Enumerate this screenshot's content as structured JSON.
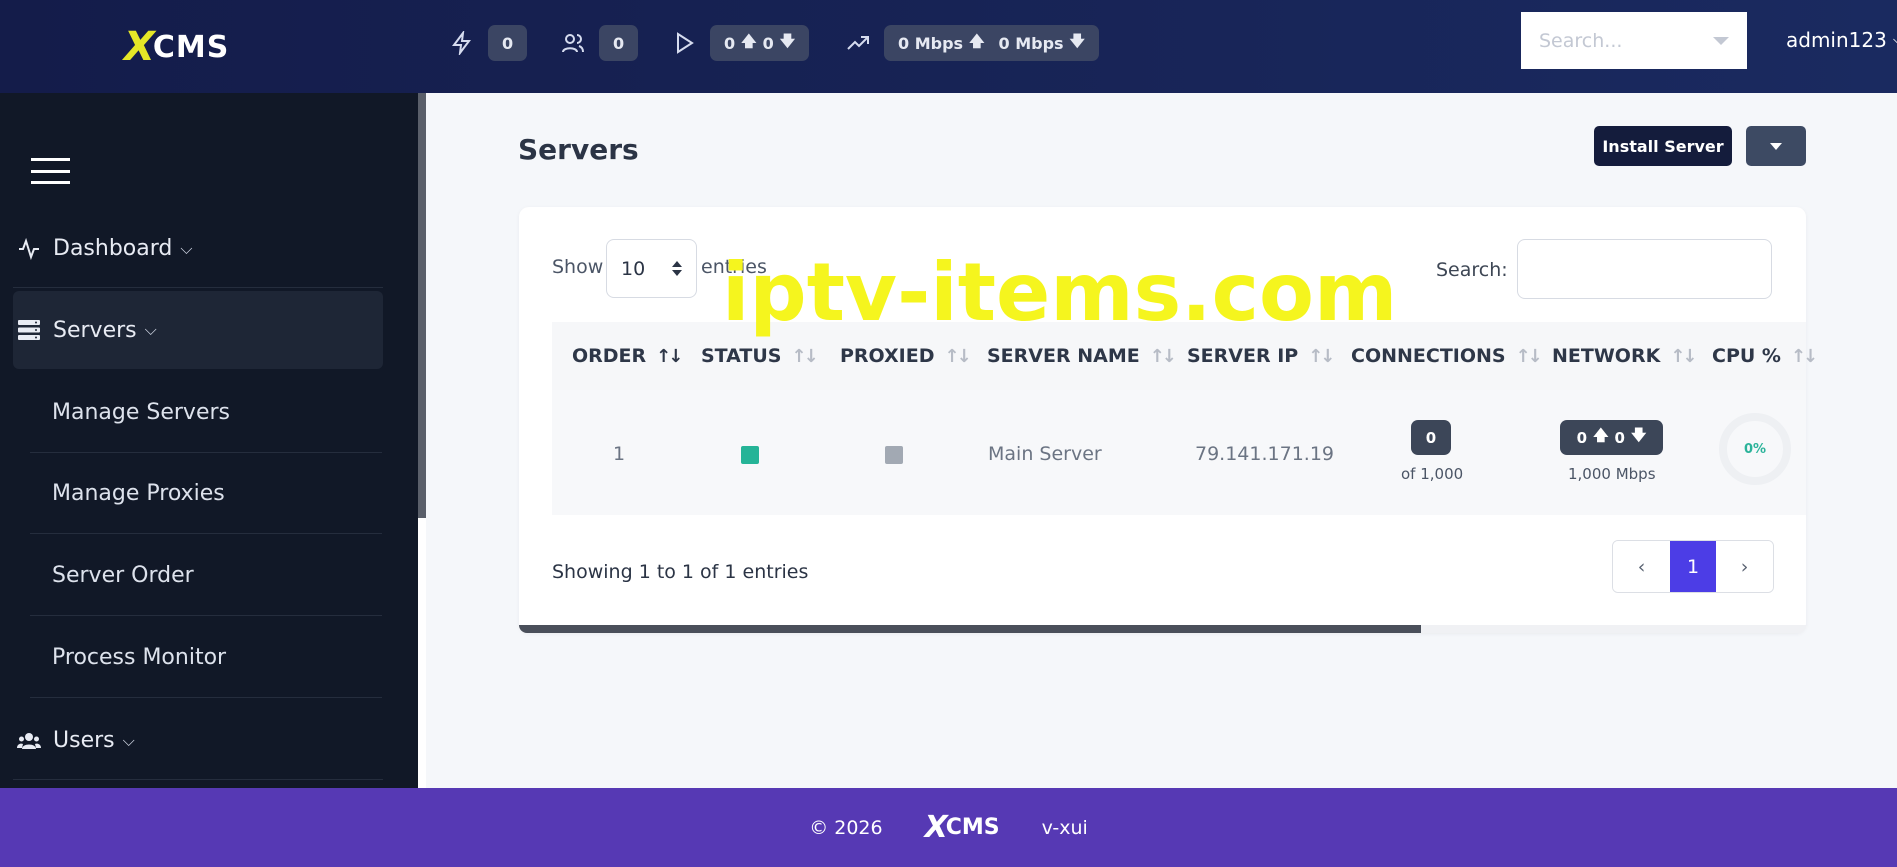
{
  "brand": {
    "x": "X",
    "cms": "CMS"
  },
  "topbar": {
    "stats": [
      {
        "icon": "lightning-icon",
        "value": "0"
      },
      {
        "icon": "users-icon",
        "value": "0"
      },
      {
        "icon": "play-icon",
        "up": "0",
        "down": "0"
      },
      {
        "icon": "trending-icon",
        "up": "0 Mbps",
        "down": "0 Mbps"
      }
    ],
    "search_placeholder": "Search...",
    "username": "admin123"
  },
  "sidebar": {
    "items": [
      {
        "label": "Dashboard",
        "icon": "activity-icon"
      },
      {
        "label": "Servers",
        "icon": "server-icon"
      },
      {
        "label": "Users",
        "icon": "users-icon"
      }
    ],
    "subitems": [
      "Manage Servers",
      "Manage Proxies",
      "Server Order",
      "Process Monitor"
    ]
  },
  "page": {
    "title": "Servers",
    "install_button": "Install Server"
  },
  "table": {
    "show_label": "Show",
    "entries_value": "10",
    "entries_label": "entries",
    "search_label": "Search:",
    "columns": [
      "ORDER",
      "STATUS",
      "PROXIED",
      "SERVER NAME",
      "SERVER IP",
      "CONNECTIONS",
      "NETWORK",
      "CPU %"
    ],
    "row": {
      "order": "1",
      "status_color": "#25b497",
      "proxied_color": "#a2a9b3",
      "server_name": "Main Server",
      "server_ip": "79.141.171.19",
      "connections": "0",
      "connections_of": "of 1,000",
      "net_up": "0",
      "net_down": "0",
      "network_cap": "1,000 Mbps",
      "cpu": "0%"
    },
    "showing": "Showing 1 to 1 of 1 entries",
    "pager": {
      "prev": "‹",
      "page": "1",
      "next": "›"
    }
  },
  "watermark": "iptv-items.com",
  "footer": {
    "copyright": "© 2026",
    "version": "v-xui"
  }
}
